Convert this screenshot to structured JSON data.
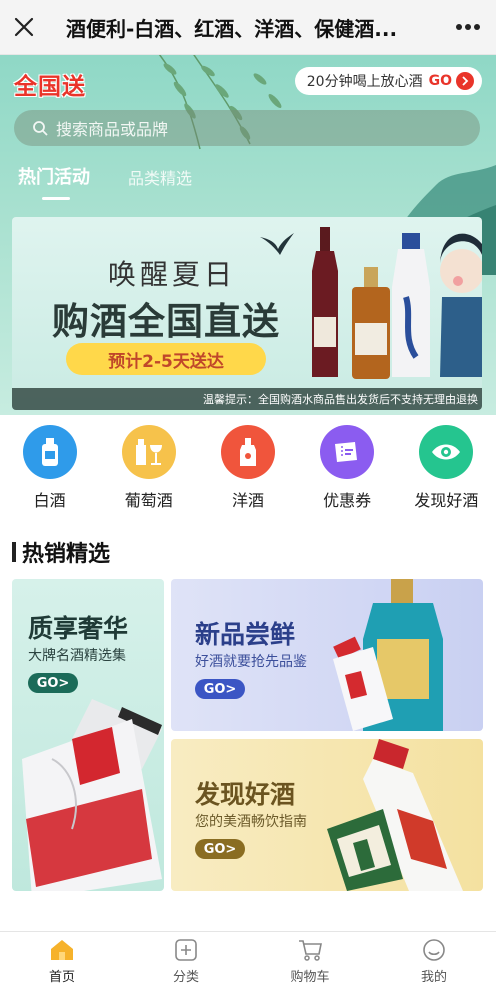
{
  "titlebar": {
    "title": "酒便利-白酒、红酒、洋酒、保健酒...",
    "close_icon": "close-icon",
    "more_icon": "more-icon"
  },
  "hero": {
    "brand": "全国送",
    "promo_text": "20分钟喝上放心酒",
    "promo_go": "GO",
    "search_placeholder": "搜索商品或品牌",
    "tabs": [
      {
        "label": "热门活动",
        "active": true
      },
      {
        "label": "品类精选",
        "active": false
      }
    ],
    "banner": {
      "headline": "唤醒夏日",
      "subheadline": "购酒全国直送",
      "delivery": "预计2-5天送达",
      "notice": "温馨提示：全国购酒水商品售出发货后不支持无理由退换"
    }
  },
  "categories": [
    {
      "label": "白酒",
      "icon": "baijiu-bottle-icon",
      "color": "#2f9bea"
    },
    {
      "label": "葡萄酒",
      "icon": "wine-glass-icon",
      "color": "#f6c24b"
    },
    {
      "label": "洋酒",
      "icon": "liquor-bottle-icon",
      "color": "#f0553c"
    },
    {
      "label": "优惠券",
      "icon": "coupon-icon",
      "color": "#8b5cf0"
    },
    {
      "label": "发现好酒",
      "icon": "eye-icon",
      "color": "#25c58f"
    }
  ],
  "section": {
    "title": "热销精选"
  },
  "cards": {
    "big": {
      "title": "质享奢华",
      "subtitle": "大牌名酒精选集",
      "go": "GO>"
    },
    "top_right": {
      "title": "新品尝鲜",
      "subtitle": "好酒就要抢先品鉴",
      "go": "GO>"
    },
    "bottom_right": {
      "title": "发现好酒",
      "subtitle": "您的美酒畅饮指南",
      "go": "GO>"
    }
  },
  "bottomnav": [
    {
      "label": "首页",
      "icon": "home-icon",
      "active": true
    },
    {
      "label": "分类",
      "icon": "category-plus-icon",
      "active": false
    },
    {
      "label": "购物车",
      "icon": "cart-icon",
      "active": false
    },
    {
      "label": "我的",
      "icon": "smiley-profile-icon",
      "active": false
    }
  ],
  "colors": {
    "accent_red": "#e9342a",
    "hero_teal": "#a9e1d0",
    "nav_active": "#f6b22b"
  }
}
